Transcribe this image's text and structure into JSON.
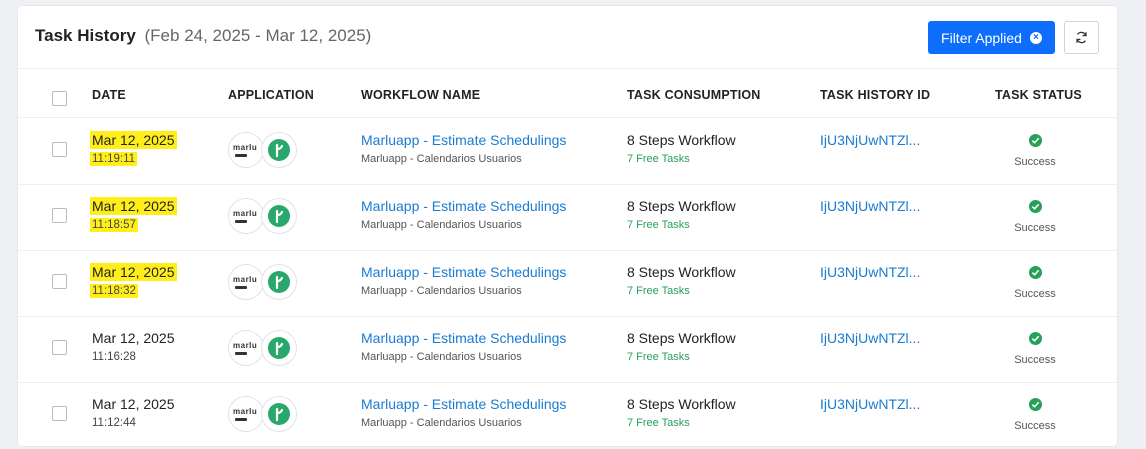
{
  "header": {
    "title": "Task History",
    "date_range": "(Feb 24, 2025 - Mar 12, 2025)",
    "filter_label": "Filter Applied"
  },
  "columns": {
    "date": "DATE",
    "application": "APPLICATION",
    "workflow": "WORKFLOW NAME",
    "consumption": "TASK CONSUMPTION",
    "history_id": "TASK HISTORY ID",
    "status": "TASK STATUS"
  },
  "app_icon_text": "marlu",
  "colors": {
    "accent": "#0d6efd",
    "link": "#1a7bd1",
    "success": "#27a05a",
    "highlight": "#ffee1a"
  },
  "rows": [
    {
      "date": "Mar 12, 2025",
      "time": "11:19:11",
      "workflow": "Marluapp - Estimate Schedulings",
      "workflow_sub": "Marluapp - Calendarios Usuarios",
      "consumption": "8 Steps Workflow",
      "free_tasks": "7 Free Tasks",
      "history_id": "IjU3NjUwNTZl...",
      "status": "Success",
      "highlighted": true
    },
    {
      "date": "Mar 12, 2025",
      "time": "11:18:57",
      "workflow": "Marluapp - Estimate Schedulings",
      "workflow_sub": "Marluapp - Calendarios Usuarios",
      "consumption": "8 Steps Workflow",
      "free_tasks": "7 Free Tasks",
      "history_id": "IjU3NjUwNTZl...",
      "status": "Success",
      "highlighted": true
    },
    {
      "date": "Mar 12, 2025",
      "time": "11:18:32",
      "workflow": "Marluapp - Estimate Schedulings",
      "workflow_sub": "Marluapp - Calendarios Usuarios",
      "consumption": "8 Steps Workflow",
      "free_tasks": "7 Free Tasks",
      "history_id": "IjU3NjUwNTZl...",
      "status": "Success",
      "highlighted": true
    },
    {
      "date": "Mar 12, 2025",
      "time": "11:16:28",
      "workflow": "Marluapp - Estimate Schedulings",
      "workflow_sub": "Marluapp - Calendarios Usuarios",
      "consumption": "8 Steps Workflow",
      "free_tasks": "7 Free Tasks",
      "history_id": "IjU3NjUwNTZl...",
      "status": "Success",
      "highlighted": false
    },
    {
      "date": "Mar 12, 2025",
      "time": "11:12:44",
      "workflow": "Marluapp - Estimate Schedulings",
      "workflow_sub": "Marluapp - Calendarios Usuarios",
      "consumption": "8 Steps Workflow",
      "free_tasks": "7 Free Tasks",
      "history_id": "IjU3NjUwNTZl...",
      "status": "Success",
      "highlighted": false
    }
  ]
}
